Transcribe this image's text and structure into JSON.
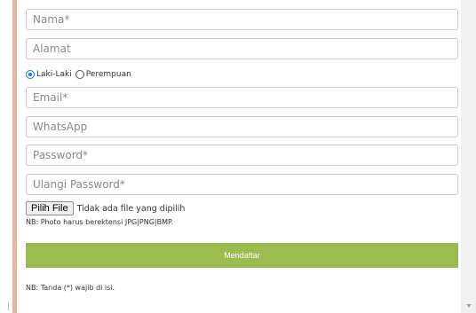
{
  "form": {
    "name_placeholder": "Nama*",
    "address_placeholder": "Alamat",
    "gender_options": [
      "Laki-Laki",
      "Perempuan"
    ],
    "gender_selected": "Laki-Laki",
    "email_placeholder": "Email*",
    "whatsapp_placeholder": "WhatsApp",
    "password_placeholder": "Password*",
    "confirm_password_placeholder": "Ulangi Password*",
    "file_button_label": "Pilih File",
    "file_status": "Tidak ada file yang dipilih",
    "photo_note": "NB: Photo harus berektensi JPG|PNG|BMP.",
    "submit_label": "Mendaftar",
    "required_note": "NB: Tanda (*) wajib di isi."
  },
  "colors": {
    "submit_bg": "#9cbb4e",
    "left_accent": "#e0b8a4",
    "radio_checked": "#1a73e8"
  }
}
